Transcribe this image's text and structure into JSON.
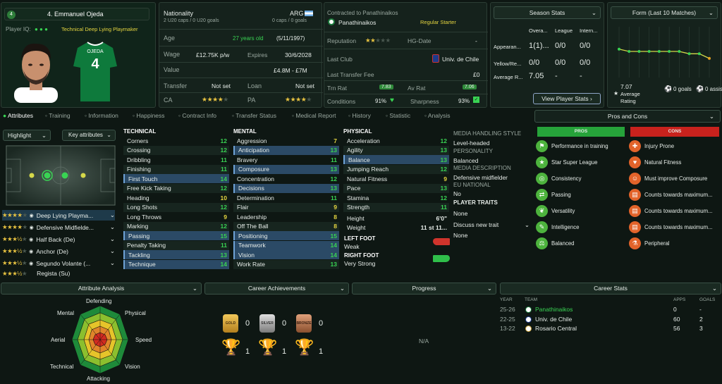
{
  "header": {
    "player_name": "4. Emmanuel Ojeda",
    "number_badge": "4",
    "player_iq_label": "Player IQ:",
    "player_role": "Technical Deep Lying Playmaker",
    "shirt_name": "OJEDA",
    "shirt_number": "4"
  },
  "bio": {
    "nationality_label": "Nationality",
    "nationality_value": "ARG",
    "caps_line": "2 U20 caps / 0 U20 goals",
    "caps_right": "0 caps / 0 goals",
    "age_label": "Age",
    "age_value": "27 years old",
    "dob": "(5/11/1997)",
    "wage_label": "Wage",
    "wage_value": "£12.75K p/w",
    "expires_label": "Expires",
    "expires_value": "30/6/2028",
    "value_label": "Value",
    "value_value": "£4.8M - £7M",
    "transfer_label": "Transfer",
    "transfer_value": "Not set",
    "loan_label": "Loan",
    "loan_value": "Not set",
    "ca_label": "CA",
    "pa_label": "PA",
    "ca_stars": 4,
    "pa_stars": 4
  },
  "contract": {
    "contracted_label": "Contracted to Panathinaikos",
    "club": "Panathinaikos",
    "status": "Regular Starter",
    "reputation_label": "Reputation",
    "hg_label": "HG-Date",
    "hg_value": "-",
    "last_club_label": "Last Club",
    "last_club_value": "Univ. de Chile",
    "last_fee_label": "Last Transfer Fee",
    "last_fee_value": "£0",
    "trn_rat_label": "Trn Rat",
    "trn_rat_value": "7.83",
    "av_rat_label": "Av Rat",
    "av_rat_value": "7.06",
    "conditions_label": "Conditions",
    "conditions_value": "91%",
    "sharpness_label": "Sharpness",
    "sharpness_value": "93%"
  },
  "season_stats": {
    "title": "Season Stats",
    "cols": [
      "Overa...",
      "League",
      "Intern..."
    ],
    "rows": [
      {
        "label": "Appearan...",
        "v": [
          "1(1)...",
          "0/0",
          "0/0"
        ]
      },
      {
        "label": "Yellow/Re...",
        "v": [
          "0/0",
          "0/0",
          "0/0"
        ]
      },
      {
        "label": "Average R...",
        "v": [
          "7.05",
          "-",
          "-"
        ]
      }
    ],
    "button": "View Player Stats"
  },
  "form": {
    "title": "Form (Last 10 Matches)",
    "avg_rating": "7.07",
    "avg_label": "Average Rating",
    "goals": "0 goals",
    "assists": "0 assists",
    "points": [
      7.1,
      7.0,
      7.0,
      7.0,
      7.0,
      7.0,
      7.0,
      6.9,
      6.9,
      6.7
    ]
  },
  "tabs": [
    "Attributes",
    "Training",
    "Information",
    "Happiness",
    "Contract Info",
    "Transfer Status",
    "Medical Report",
    "History",
    "Statistic",
    "Analysis"
  ],
  "controls": {
    "highlight": "Highlight",
    "key_attributes": "Key attributes"
  },
  "technical": {
    "title": "TECHNICAL",
    "items": [
      {
        "n": "Corners",
        "v": "12",
        "c": "g",
        "h": false
      },
      {
        "n": "Crossing",
        "v": "12",
        "c": "g",
        "h": false
      },
      {
        "n": "Dribbling",
        "v": "11",
        "c": "g",
        "h": false
      },
      {
        "n": "Finishing",
        "v": "11",
        "c": "g",
        "h": false
      },
      {
        "n": "First Touch",
        "v": "14",
        "c": "g",
        "h": true
      },
      {
        "n": "Free Kick Taking",
        "v": "12",
        "c": "g",
        "h": false
      },
      {
        "n": "Heading",
        "v": "10",
        "c": "y",
        "h": false
      },
      {
        "n": "Long Shots",
        "v": "12",
        "c": "g",
        "h": false
      },
      {
        "n": "Long Throws",
        "v": "9",
        "c": "y",
        "h": false
      },
      {
        "n": "Marking",
        "v": "12",
        "c": "g",
        "h": false
      },
      {
        "n": "Passing",
        "v": "15",
        "c": "g",
        "h": true
      },
      {
        "n": "Penalty Taking",
        "v": "11",
        "c": "g",
        "h": false
      },
      {
        "n": "Tackling",
        "v": "13",
        "c": "g",
        "h": true
      },
      {
        "n": "Technique",
        "v": "14",
        "c": "g",
        "h": true
      }
    ]
  },
  "mental": {
    "title": "MENTAL",
    "items": [
      {
        "n": "Aggression",
        "v": "7",
        "c": "y",
        "h": false
      },
      {
        "n": "Anticipation",
        "v": "13",
        "c": "g",
        "h": true
      },
      {
        "n": "Bravery",
        "v": "11",
        "c": "g",
        "h": false
      },
      {
        "n": "Composure",
        "v": "13",
        "c": "g",
        "h": true
      },
      {
        "n": "Concentration",
        "v": "12",
        "c": "g",
        "h": false
      },
      {
        "n": "Decisions",
        "v": "13",
        "c": "g",
        "h": true
      },
      {
        "n": "Determination",
        "v": "11",
        "c": "g",
        "h": false
      },
      {
        "n": "Flair",
        "v": "9",
        "c": "y",
        "h": false
      },
      {
        "n": "Leadership",
        "v": "8",
        "c": "y",
        "h": false
      },
      {
        "n": "Off The Ball",
        "v": "8",
        "c": "y",
        "h": false
      },
      {
        "n": "Positioning",
        "v": "15",
        "c": "g",
        "h": true
      },
      {
        "n": "Teamwork",
        "v": "14",
        "c": "g",
        "h": true
      },
      {
        "n": "Vision",
        "v": "14",
        "c": "g",
        "h": true
      },
      {
        "n": "Work Rate",
        "v": "13",
        "c": "g",
        "h": false
      }
    ]
  },
  "physical": {
    "title": "PHYSICAL",
    "items": [
      {
        "n": "Acceleration",
        "v": "12",
        "c": "g",
        "h": false
      },
      {
        "n": "Agility",
        "v": "13",
        "c": "g",
        "h": false
      },
      {
        "n": "Balance",
        "v": "13",
        "c": "g",
        "h": true
      },
      {
        "n": "Jumping Reach",
        "v": "12",
        "c": "g",
        "h": false
      },
      {
        "n": "Natural Fitness",
        "v": "9",
        "c": "y",
        "h": false
      },
      {
        "n": "Pace",
        "v": "13",
        "c": "g",
        "h": false
      },
      {
        "n": "Stamina",
        "v": "12",
        "c": "g",
        "h": false
      },
      {
        "n": "Strength",
        "v": "11",
        "c": "g",
        "h": false
      }
    ]
  },
  "body": {
    "height_label": "Height",
    "height_value": "6'0\"",
    "weight_label": "Weight",
    "weight_value": "11 st 11...",
    "left_foot_label": "LEFT FOOT",
    "left_foot_value": "Weak",
    "right_foot_label": "RIGHT FOOT",
    "right_foot_value": "Very Strong"
  },
  "media": {
    "handling_title": "MEDIA HANDLING STYLE",
    "handling_value": "Level-headed",
    "personality_title": "PERSONALITY",
    "personality_value": "Balanced",
    "description_title": "MEDIA DESCRIPTION",
    "description_value": "Defensive midfielder",
    "eu_title": "EU NATIONAL",
    "eu_value": "No",
    "traits_title": "PLAYER TRAITS",
    "traits_value": "None",
    "discuss": "Discuss new trait",
    "discuss_value": "None"
  },
  "roles": [
    {
      "stars": 4,
      "half": false,
      "name": "Deep Lying Playma..."
    },
    {
      "stars": 4,
      "half": false,
      "name": "Defensive Midfielde..."
    },
    {
      "stars": 3,
      "half": true,
      "name": "Half Back (De)"
    },
    {
      "stars": 3,
      "half": true,
      "name": "Anchor (De)"
    },
    {
      "stars": 3,
      "half": true,
      "name": "Segundo Volante (..."
    },
    {
      "stars": 3,
      "half": true,
      "name": "Regista (Su)"
    }
  ],
  "pros_cons": {
    "title": "Pros and Cons",
    "pros_label": "PROS",
    "cons_label": "CONS",
    "pros": [
      "Performance in training",
      "Star Super League",
      "Consistency",
      "Passing",
      "Versatility",
      "Intelligence",
      "Balanced"
    ],
    "cons": [
      "Injury Prone",
      "Natural Fitness",
      "Must improve Composure",
      "Counts towards maximum...",
      "Counts towards maximum...",
      "Counts towards maximum...",
      "Peripheral"
    ],
    "pro_icons": [
      "whistle-icon",
      "star-icon",
      "target-icon",
      "pass-icon",
      "leaf-icon",
      "brain-icon",
      "balance-icon"
    ],
    "con_icons": [
      "medical-cross-icon",
      "heart-icon",
      "person-icon",
      "document-icon",
      "document-icon",
      "document-icon",
      "flask-icon"
    ]
  },
  "analysis": {
    "title": "Attribute Analysis",
    "labels": [
      "Defending",
      "Physical",
      "Speed",
      "Vision",
      "Attacking",
      "Technical",
      "Aerial",
      "Mental"
    ]
  },
  "achievements": {
    "title": "Career Achievements",
    "gold": "0",
    "silver": "0",
    "bronze": "0",
    "t1": "1",
    "t2": "1",
    "t3": "1",
    "gold_label": "GOLD",
    "silver_label": "SILVER",
    "bronze_label": "BRONZE"
  },
  "progress": {
    "title": "Progress",
    "value": "N/A"
  },
  "career": {
    "title": "Career Stats",
    "cols": [
      "YEAR",
      "TEAM",
      "APPS",
      "GOALS"
    ],
    "rows": [
      {
        "year": "25-26",
        "team": "Panathinaikos",
        "apps": "0",
        "goals": "-",
        "hl": true
      },
      {
        "year": "22-25",
        "team": "Univ. de Chile",
        "apps": "60",
        "goals": "2",
        "hl": false
      },
      {
        "year": "13-22",
        "team": "Rosario Central",
        "apps": "56",
        "goals": "3",
        "hl": false
      }
    ]
  }
}
